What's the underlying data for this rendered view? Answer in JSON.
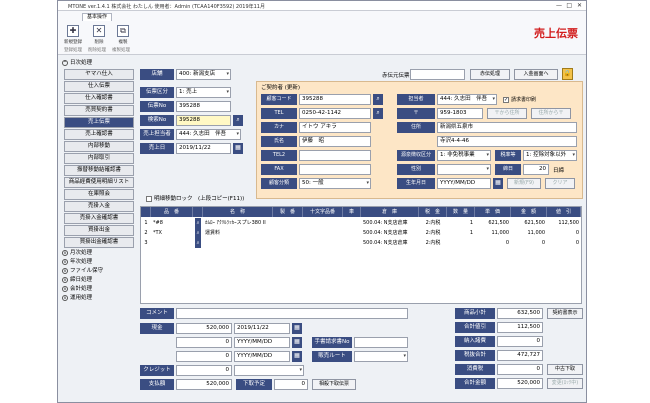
{
  "window": {
    "title": "MTONE ver.1.4.1 株式会社 わたしん 使用者：Admin (TCAA140F3592) 2019年11月",
    "big_title": "売上伝票"
  },
  "ribbon": {
    "tab": "基本操作",
    "buttons": [
      "新規登録",
      "削除",
      "複製"
    ],
    "sections": [
      "登録処理",
      "削除処理",
      "複製処理"
    ]
  },
  "sidebar": {
    "group_top": "日次処理",
    "items": [
      "ヤマハ仕入",
      "仕入伝票",
      "仕入確認書",
      "売買契約書",
      "売上伝票",
      "売上確認書",
      "内部移動",
      "内部取引",
      "振替移動結確認書",
      "商品経費使用明細リスト",
      "在庫照会",
      "売掛入金",
      "売掛入金確認書",
      "買掛出金",
      "買掛出金確認書"
    ],
    "active_index": 4,
    "groups": [
      "月次処理",
      "年次処理",
      "ファイル保守",
      "締日処理",
      "会計処理",
      "運用処理"
    ]
  },
  "header": {
    "store_label": "店舗",
    "store_value": "400: 新潟支店",
    "slip_type_label": "伝票区分",
    "slip_type_value": "1: 売上",
    "slip_no_label": "伝票No",
    "slip_no_value": "395288",
    "detect_no_label": "検索No",
    "detect_no_value": "395288",
    "staff_label": "売上担当者",
    "staff_value": "444: 久志田　伴吾",
    "date_label": "売上日",
    "date_value": "2019/11/22",
    "orig_slip_label": "赤伝元伝票No",
    "red_btn": "赤伝処理",
    "receipt_btn": "入金画面へ"
  },
  "customer": {
    "header": "ご契約者 (更新)",
    "code_label": "顧客コード",
    "code_value": "395288",
    "tel_label": "TEL",
    "tel_value": "0250-42-1142",
    "kana_label": "カナ",
    "kana_value": "イトウ アキラ",
    "name_label": "氏名",
    "name_value": "伊藤　昭",
    "tel2_label": "TEL2",
    "fax_label": "FAX",
    "class_label": "顧客分類",
    "class_value": "50: 一般",
    "rep_label": "担当者",
    "rep_value": "444: 久志田　伴吾",
    "zip_label": "〒",
    "zip_value": "959-1803",
    "addr_label": "住所",
    "addr_value": "新潟県五泉市",
    "addr2_value": "寺沢4-4-46",
    "member_label": "源泉徴収区分",
    "member_value": "1: 非免税事業",
    "tax_label": "税率等",
    "tax_value": "1: 控除対象以外",
    "gender_label": "性別",
    "close_label": "締日",
    "close_value": "20",
    "close_unit": "日締",
    "birth_label": "生年月日",
    "birth_value": "YYYY/MM/DD",
    "print_label": "請求書印刷",
    "zip_btn": "〒から住所",
    "addr_btn": "住所から〒",
    "new_btn": "新規(F9)",
    "clear_btn": "クリア"
  },
  "options": {
    "lock_label": "明細移動ロック",
    "copy_label": "(上段コピー(F11))"
  },
  "table": {
    "headers": [
      "",
      "品　番",
      "",
      "名　称",
      "製　番",
      "十文字品番",
      "車",
      "倉　庫",
      "税　金",
      "数　量",
      "単　価",
      "金　額",
      "値　引"
    ],
    "rows": [
      [
        "1",
        "*#8",
        "",
        "ｶﾑﾛｰ ｱｸﾘﾙﾗｯｶｰスプレ380 II",
        "",
        "",
        "",
        "500.04: N支店倉庫",
        "2:内税",
        "1",
        "621,500",
        "621,500",
        "112,500"
      ],
      [
        "2",
        "*TX",
        "",
        "運賃料",
        "",
        "",
        "",
        "500.04: N支店倉庫",
        "2:内税",
        "1",
        "11,000",
        "11,000",
        "0"
      ],
      [
        "3",
        "",
        "",
        "",
        "",
        "",
        "",
        "500.04: N支店倉庫",
        "2:内税",
        "",
        "0",
        "0",
        "0"
      ]
    ]
  },
  "footer": {
    "comment_label": "コメント",
    "cash_label": "現金",
    "cash_amount": "520,000",
    "cash_date": "2019/11/22",
    "row2_amount": "0",
    "row2_date": "YYYY/MM/DD",
    "row3_amount": "0",
    "row3_date": "YYYY/MM/DD",
    "credit_label": "クレジット",
    "credit_amount": "0",
    "payment_label": "支払額",
    "payment_amount": "520,000",
    "schedule_label": "下取予定",
    "schedule_amount": "0",
    "trade_btn": "相殺下取伝票",
    "invoice_no_label": "手書請求書No",
    "sales_route_label": "販売ルート",
    "subtotal_label": "商品小計",
    "subtotal_value": "632,500",
    "discount_label": "合計値引",
    "discount_value": "112,500",
    "deposit_label": "納入諸費",
    "deposit_value": "0",
    "tax_excl_label": "税抜合計",
    "tax_excl_value": "472,727",
    "tax_label": "消費税",
    "tax_value": "0",
    "total_label": "合計金額",
    "total_value": "520,000",
    "contract_btn": "契約書表示",
    "midtrade_btn": "中古下取",
    "history_btn": "変更(ﾛｯｸ中)"
  }
}
